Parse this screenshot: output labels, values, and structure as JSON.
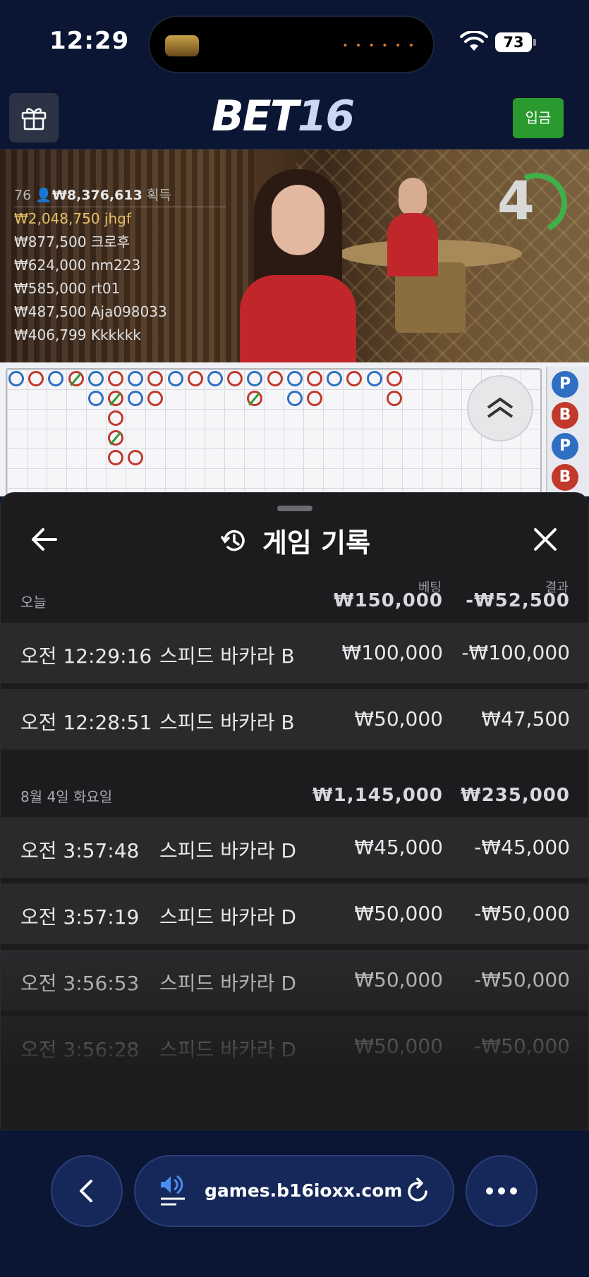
{
  "status_bar": {
    "time": "12:29",
    "battery": "73"
  },
  "header": {
    "logo_main": "BET",
    "logo_num": "16",
    "deposit_label": "입금"
  },
  "video": {
    "winners_count": "76",
    "winners_total": "₩8,376,613",
    "winners_suffix": "획득",
    "winners": [
      {
        "amount": "₩2,048,750",
        "name": "jhgf"
      },
      {
        "amount": "₩877,500",
        "name": "크로후"
      },
      {
        "amount": "₩624,000",
        "name": "nm223"
      },
      {
        "amount": "₩585,000",
        "name": "rt01"
      },
      {
        "amount": "₩487,500",
        "name": "Aja098033"
      },
      {
        "amount": "₩406,799",
        "name": "Kkkkkk"
      }
    ],
    "countdown": "4"
  },
  "roadmap": {
    "side_labels": [
      "P",
      "B",
      "P",
      "B"
    ]
  },
  "history": {
    "title": "게임 기록",
    "col_bet": "베팅",
    "col_result": "결과",
    "groups": [
      {
        "date": "오늘",
        "bet_total": "₩150,000",
        "result_total": "-₩52,500",
        "rows": [
          {
            "time": "오전 12:29:16",
            "game": "스피드 바카라 B",
            "bet": "₩100,000",
            "result": "-₩100,000"
          },
          {
            "time": "오전 12:28:51",
            "game": "스피드 바카라 B",
            "bet": "₩50,000",
            "result": "₩47,500"
          }
        ]
      },
      {
        "date": "8월 4일 화요일",
        "bet_total": "₩1,145,000",
        "result_total": "₩235,000",
        "rows": [
          {
            "time": "오전 3:57:48",
            "game": "스피드 바카라 D",
            "bet": "₩45,000",
            "result": "-₩45,000"
          },
          {
            "time": "오전 3:57:19",
            "game": "스피드 바카라 D",
            "bet": "₩50,000",
            "result": "-₩50,000"
          },
          {
            "time": "오전 3:56:53",
            "game": "스피드 바카라 D",
            "bet": "₩50,000",
            "result": "-₩50,000"
          },
          {
            "time": "오전 3:56:28",
            "game": "스피드 바카라 D",
            "bet": "₩50,000",
            "result": "-₩50,000"
          }
        ]
      }
    ]
  },
  "browser": {
    "url": "games.b16ioxx.com"
  }
}
